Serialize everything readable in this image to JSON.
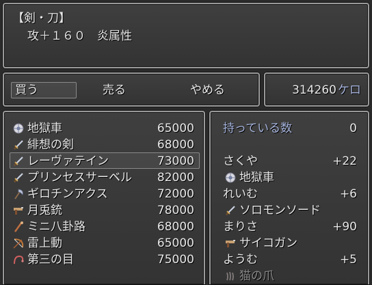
{
  "description": {
    "category": "【剣・刀】",
    "stats": "攻＋１６０　炎属性"
  },
  "commands": {
    "buy": "買う",
    "sell": "売る",
    "quit": "やめる"
  },
  "money": {
    "amount": "314260",
    "unit": "ケロ"
  },
  "shop_items": [
    {
      "name": "地獄車",
      "price": "65000",
      "icon": "wheel-icon"
    },
    {
      "name": "緋想の剣",
      "price": "68000",
      "icon": "sword-icon"
    },
    {
      "name": "レーヴァテイン",
      "price": "73000",
      "icon": "sword-icon"
    },
    {
      "name": "プリンセスサーベル",
      "price": "82000",
      "icon": "sword-icon"
    },
    {
      "name": "ギロチンアクス",
      "price": "72000",
      "icon": "axe-icon"
    },
    {
      "name": "月兎銃",
      "price": "78000",
      "icon": "gun-icon"
    },
    {
      "name": "ミニ八卦路",
      "price": "68000",
      "icon": "staff-icon"
    },
    {
      "name": "雷上動",
      "price": "65000",
      "icon": "bow-icon"
    },
    {
      "name": "第三の目",
      "price": "75000",
      "icon": "whip-icon"
    }
  ],
  "selected_index": 2,
  "owned": {
    "label": "持っている数",
    "count": "0"
  },
  "party": [
    {
      "character": "さくや",
      "change": "+22",
      "equipped": "地獄車",
      "equipped_icon": "wheel-icon"
    },
    {
      "character": "れいむ",
      "change": "+6",
      "equipped": "ソロモンソード",
      "equipped_icon": "sword-icon"
    },
    {
      "character": "まりさ",
      "change": "+90",
      "equipped": "サイコガン",
      "equipped_icon": "gun-icon"
    },
    {
      "character": "ようむ",
      "change": "+5",
      "equipped": "猫の爪",
      "equipped_icon": "claw-icon"
    }
  ]
}
